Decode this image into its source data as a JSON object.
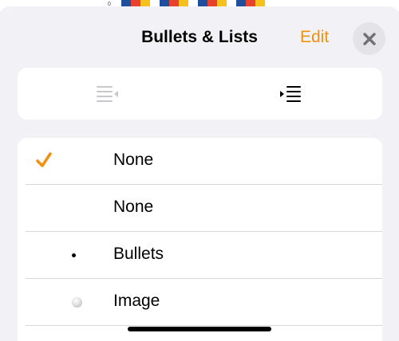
{
  "background": {
    "digit": "0",
    "thumbs": [
      [
        "#1f4e9c",
        "#e8412e",
        "#f5c21b"
      ],
      [
        "#1f4e9c",
        "#e8412e",
        "#f5c21b"
      ],
      [
        "#1f4e9c",
        "#e8412e",
        "#f5c21b"
      ],
      [
        "#1f4e9c",
        "#e8412e",
        "#f5c21b"
      ]
    ]
  },
  "header": {
    "title": "Bullets & Lists",
    "edit_label": "Edit",
    "close_icon": "close-icon"
  },
  "segmented": {
    "items": [
      {
        "icon": "decrease-indent-icon",
        "enabled": false
      },
      {
        "icon": "increase-indent-icon",
        "enabled": true
      }
    ]
  },
  "list": {
    "items": [
      {
        "label": "None",
        "marker": "checkmark-icon",
        "selected": true
      },
      {
        "label": "None",
        "marker": "none",
        "selected": false
      },
      {
        "label": "Bullets",
        "marker": "bullet-dot-icon",
        "selected": false
      },
      {
        "label": "Image",
        "marker": "image-bullet-icon",
        "selected": false
      }
    ]
  },
  "colors": {
    "accent": "#f0920f",
    "background": "#f2f1f6",
    "card": "#ffffff",
    "disabled_icon": "#c7c7cc"
  }
}
